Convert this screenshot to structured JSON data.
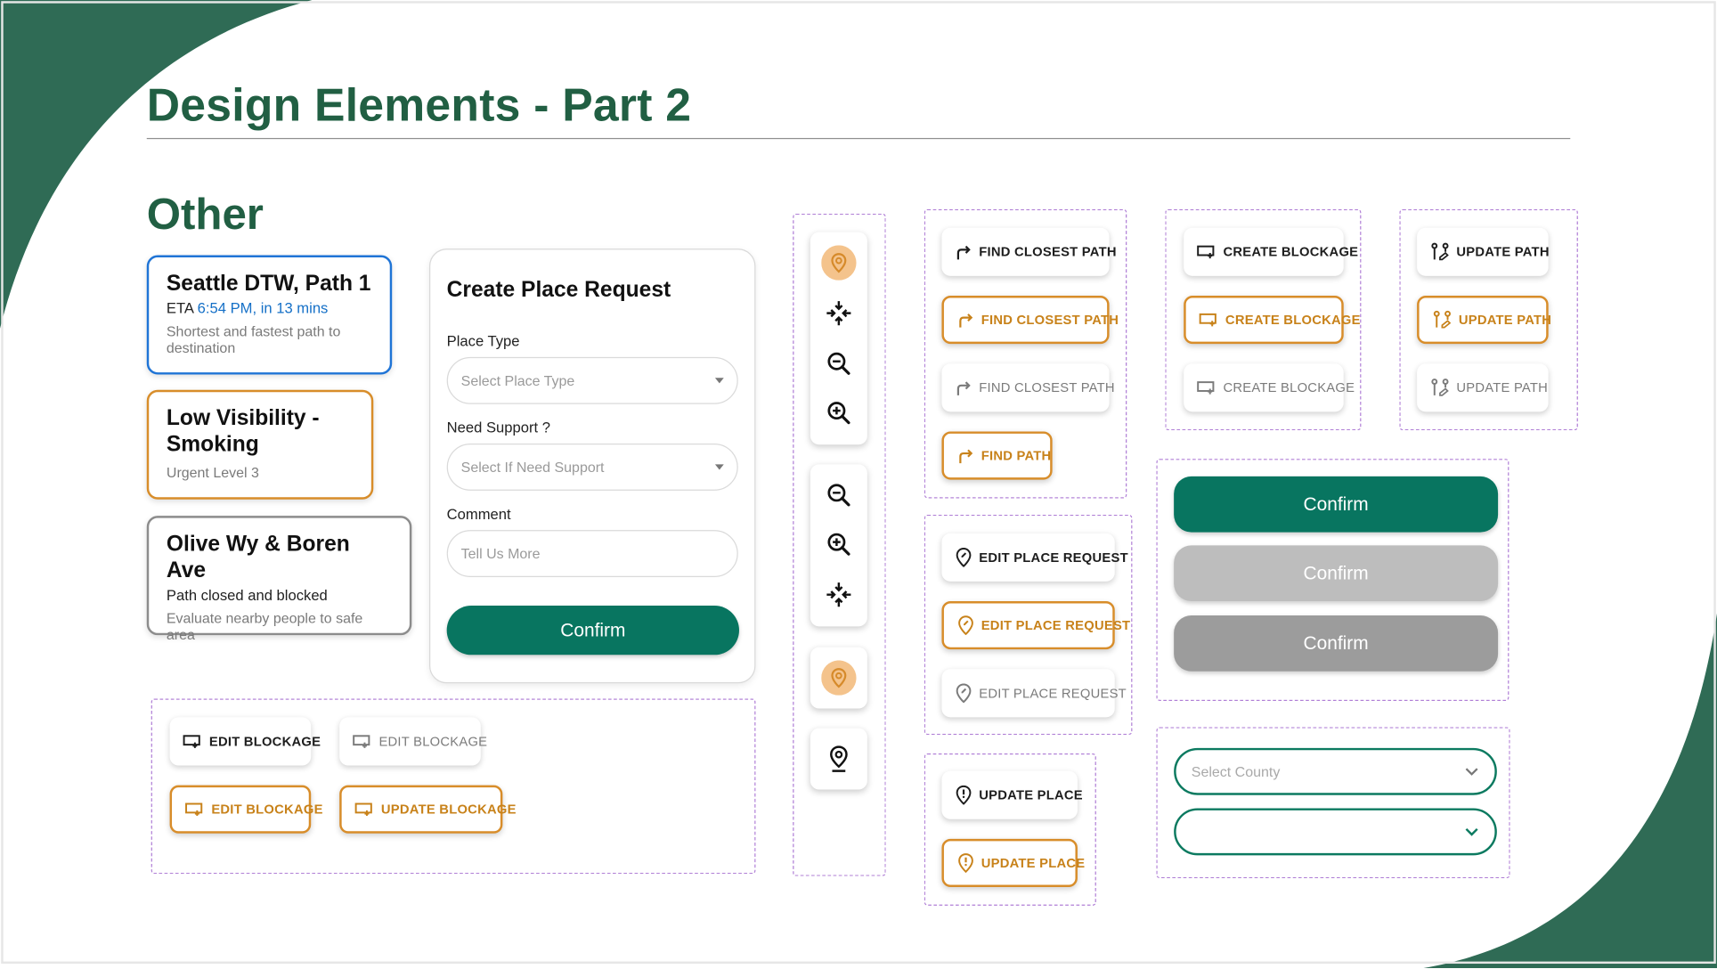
{
  "page": {
    "title": "Design Elements - Part 2",
    "section_title": "Other"
  },
  "colors": {
    "brand_green": "#215f43",
    "background_green": "#2f6b55",
    "primary_button": "#087560",
    "accent_orange": "#d88d2a",
    "info_blue": "#1f74d6",
    "disabled_light": "#bdbdbd",
    "disabled_dark": "#9c9c9c",
    "dashed_outline": "#b07fd6"
  },
  "cards": [
    {
      "title": "Seattle DTW, Path 1",
      "eta_prefix": "ETA ",
      "eta_time": "6:54 PM, in 13 mins",
      "description": "Shortest and fastest path to destination"
    },
    {
      "title": "Low Visibility - Smoking",
      "description": "Urgent Level 3"
    },
    {
      "title": "Olive Wy & Boren Ave",
      "subtitle": "Path closed and blocked",
      "description": "Evaluate nearby people to safe area"
    }
  ],
  "form": {
    "title": "Create Place Request",
    "place_type_label": "Place Type",
    "place_type_placeholder": "Select Place Type",
    "need_support_label": "Need Support ?",
    "need_support_placeholder": "Select If Need Support",
    "comment_label": "Comment",
    "comment_placeholder": "Tell Us More",
    "confirm_label": "Confirm"
  },
  "buttons": {
    "edit_blockage": "EDIT BLOCKAGE",
    "update_blockage": "UPDATE BLOCKAGE",
    "find_closest_path": "FIND CLOSEST PATH",
    "find_path": "FIND PATH",
    "create_blockage": "CREATE BLOCKAGE",
    "update_path": "UPDATE PATH",
    "edit_place_request": "EDIT PLACE REQUEST",
    "update_place": "UPDATE PLACE",
    "confirm": "Confirm",
    "select_county_placeholder": "Select County"
  },
  "icons": {
    "toolbar_top": [
      "location-pin-icon",
      "recenter-icon",
      "zoom-out-icon",
      "zoom-in-icon"
    ],
    "toolbar_middle": [
      "zoom-out-icon",
      "zoom-in-icon",
      "recenter-icon"
    ],
    "toolbar_bottom": [
      "location-pin-icon",
      "location-pin-icon"
    ]
  }
}
